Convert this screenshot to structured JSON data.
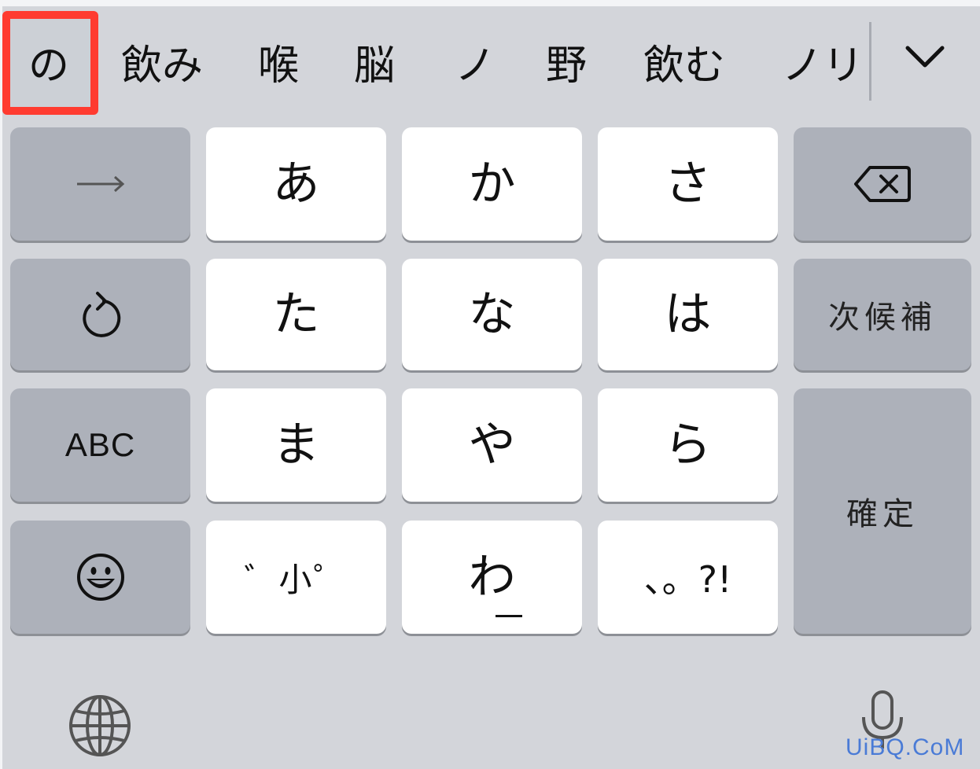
{
  "candidates": {
    "items": [
      "の",
      "飲み",
      "喉",
      "脳",
      "ノ",
      "野",
      "飲む",
      "ノリ"
    ],
    "expand_icon": "chevron-down-icon"
  },
  "keys": {
    "row1": {
      "left_icon": "arrow-right-icon",
      "kana": [
        "あ",
        "か",
        "さ"
      ],
      "right_icon": "delete-backspace-icon"
    },
    "row2": {
      "left_icon": "undo-icon",
      "kana": [
        "た",
        "な",
        "は"
      ],
      "right_label": "次候補"
    },
    "row3": {
      "left_label": "ABC",
      "kana": [
        "ま",
        "や",
        "ら"
      ],
      "confirm_label": "確定"
    },
    "row4": {
      "left_icon": "emoji-icon",
      "dakuten_label": "゛小゜",
      "wa_label": "わ",
      "punct_label": "、。?!"
    }
  },
  "bottom": {
    "globe_icon": "globe-icon",
    "mic_icon": "microphone-icon"
  },
  "watermark": "UiBQ.CoM",
  "colors": {
    "background": "#d3d5da",
    "key_white": "#ffffff",
    "key_gray": "#adb1ba",
    "highlight": "#ff3b30"
  }
}
